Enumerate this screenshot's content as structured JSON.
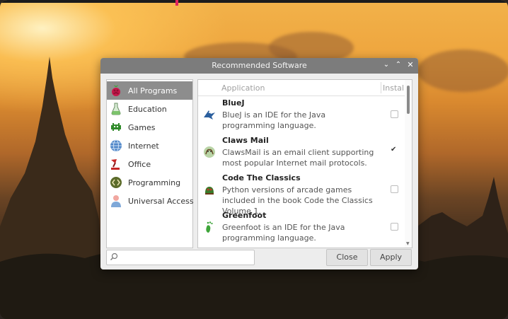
{
  "window": {
    "title": "Recommended Software",
    "controls": {
      "minimize": "⌄",
      "maximize": "⌃",
      "close": "✕"
    }
  },
  "categories": [
    {
      "label": "All Programs",
      "icon": "raspberry-icon",
      "selected": true
    },
    {
      "label": "Education",
      "icon": "flask-icon",
      "selected": false
    },
    {
      "label": "Games",
      "icon": "alien-invader-icon",
      "selected": false
    },
    {
      "label": "Internet",
      "icon": "globe-icon",
      "selected": false
    },
    {
      "label": "Office",
      "icon": "desk-lamp-icon",
      "selected": false
    },
    {
      "label": "Programming",
      "icon": "code-gear-icon",
      "selected": false
    },
    {
      "label": "Universal Access",
      "icon": "person-icon",
      "selected": false
    }
  ],
  "list": {
    "header_application": "Application",
    "header_install": "Install",
    "apps": [
      {
        "name": "BlueJ",
        "description": "BlueJ is an IDE for the Java programming language.",
        "installed": false,
        "icon": "bird-icon"
      },
      {
        "name": "Claws Mail",
        "description": "ClawsMail is an email client supporting most popular Internet mail protocols.",
        "installed": true,
        "icon": "claws-mail-icon"
      },
      {
        "name": "Code The Classics",
        "description": "Python versions of arcade games included in the book Code the Classics Volume 1.",
        "installed": false,
        "icon": "game-character-icon"
      },
      {
        "name": "Greenfoot",
        "description": "Greenfoot is an IDE for the Java programming language.",
        "installed": false,
        "icon": "green-foot-icon"
      }
    ]
  },
  "footer": {
    "search_value": "",
    "close_label": "Close",
    "apply_label": "Apply"
  },
  "colors": {
    "titlebar": "#7c7c7c",
    "selected_category": "#8d8d8d",
    "window_bg": "#ededed"
  }
}
